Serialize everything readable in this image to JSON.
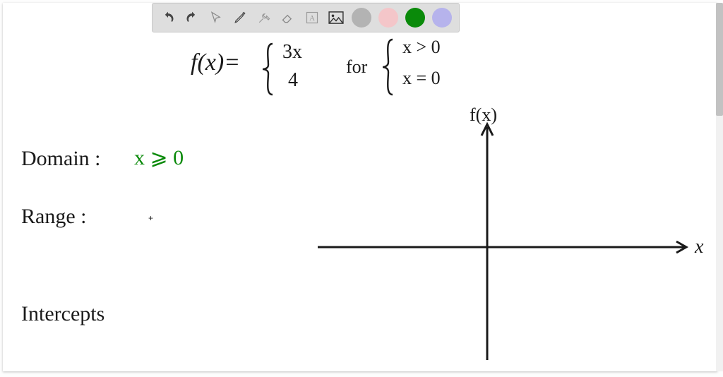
{
  "toolbar": {
    "swatches": [
      {
        "name": "swatch-gray",
        "color": "#b3b3b3"
      },
      {
        "name": "swatch-pink",
        "color": "#f4c6c9"
      },
      {
        "name": "swatch-green",
        "color": "#0a8a0a"
      },
      {
        "name": "swatch-purple",
        "color": "#b6b3ec"
      }
    ]
  },
  "handwriting": {
    "fx_eq": "f(x)=",
    "brace_top_1": "3x",
    "brace_bot_1": "4",
    "for_word": "for",
    "brace_top_2": "x > 0",
    "brace_bot_2": "x = 0",
    "domain_label": "Domain :",
    "domain_value": "x ⩾ 0",
    "range_label": "Range  :",
    "intercepts_label": "Intercepts",
    "axis_y_label": "f(x)",
    "axis_x_label": "x",
    "cursor_mark": "+"
  }
}
